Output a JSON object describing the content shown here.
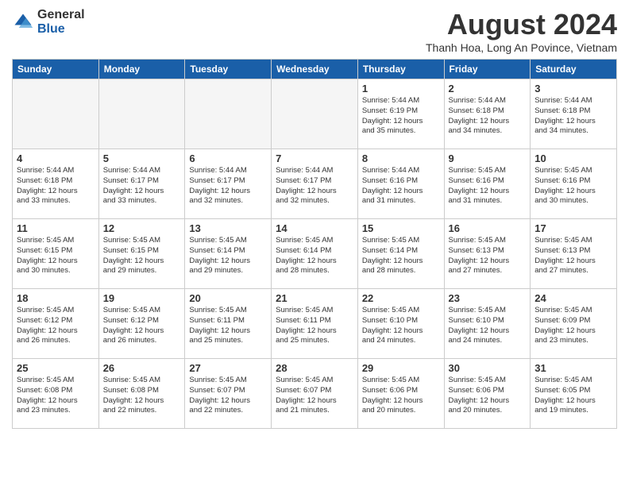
{
  "header": {
    "logo_general": "General",
    "logo_blue": "Blue",
    "month_year": "August 2024",
    "location": "Thanh Hoa, Long An Povince, Vietnam"
  },
  "weekdays": [
    "Sunday",
    "Monday",
    "Tuesday",
    "Wednesday",
    "Thursday",
    "Friday",
    "Saturday"
  ],
  "weeks": [
    [
      {
        "day": "",
        "empty": true
      },
      {
        "day": "",
        "empty": true
      },
      {
        "day": "",
        "empty": true
      },
      {
        "day": "",
        "empty": true
      },
      {
        "day": "1",
        "lines": [
          "Sunrise: 5:44 AM",
          "Sunset: 6:19 PM",
          "Daylight: 12 hours",
          "and 35 minutes."
        ]
      },
      {
        "day": "2",
        "lines": [
          "Sunrise: 5:44 AM",
          "Sunset: 6:18 PM",
          "Daylight: 12 hours",
          "and 34 minutes."
        ]
      },
      {
        "day": "3",
        "lines": [
          "Sunrise: 5:44 AM",
          "Sunset: 6:18 PM",
          "Daylight: 12 hours",
          "and 34 minutes."
        ]
      }
    ],
    [
      {
        "day": "4",
        "lines": [
          "Sunrise: 5:44 AM",
          "Sunset: 6:18 PM",
          "Daylight: 12 hours",
          "and 33 minutes."
        ]
      },
      {
        "day": "5",
        "lines": [
          "Sunrise: 5:44 AM",
          "Sunset: 6:17 PM",
          "Daylight: 12 hours",
          "and 33 minutes."
        ]
      },
      {
        "day": "6",
        "lines": [
          "Sunrise: 5:44 AM",
          "Sunset: 6:17 PM",
          "Daylight: 12 hours",
          "and 32 minutes."
        ]
      },
      {
        "day": "7",
        "lines": [
          "Sunrise: 5:44 AM",
          "Sunset: 6:17 PM",
          "Daylight: 12 hours",
          "and 32 minutes."
        ]
      },
      {
        "day": "8",
        "lines": [
          "Sunrise: 5:44 AM",
          "Sunset: 6:16 PM",
          "Daylight: 12 hours",
          "and 31 minutes."
        ]
      },
      {
        "day": "9",
        "lines": [
          "Sunrise: 5:45 AM",
          "Sunset: 6:16 PM",
          "Daylight: 12 hours",
          "and 31 minutes."
        ]
      },
      {
        "day": "10",
        "lines": [
          "Sunrise: 5:45 AM",
          "Sunset: 6:16 PM",
          "Daylight: 12 hours",
          "and 30 minutes."
        ]
      }
    ],
    [
      {
        "day": "11",
        "lines": [
          "Sunrise: 5:45 AM",
          "Sunset: 6:15 PM",
          "Daylight: 12 hours",
          "and 30 minutes."
        ]
      },
      {
        "day": "12",
        "lines": [
          "Sunrise: 5:45 AM",
          "Sunset: 6:15 PM",
          "Daylight: 12 hours",
          "and 29 minutes."
        ]
      },
      {
        "day": "13",
        "lines": [
          "Sunrise: 5:45 AM",
          "Sunset: 6:14 PM",
          "Daylight: 12 hours",
          "and 29 minutes."
        ]
      },
      {
        "day": "14",
        "lines": [
          "Sunrise: 5:45 AM",
          "Sunset: 6:14 PM",
          "Daylight: 12 hours",
          "and 28 minutes."
        ]
      },
      {
        "day": "15",
        "lines": [
          "Sunrise: 5:45 AM",
          "Sunset: 6:14 PM",
          "Daylight: 12 hours",
          "and 28 minutes."
        ]
      },
      {
        "day": "16",
        "lines": [
          "Sunrise: 5:45 AM",
          "Sunset: 6:13 PM",
          "Daylight: 12 hours",
          "and 27 minutes."
        ]
      },
      {
        "day": "17",
        "lines": [
          "Sunrise: 5:45 AM",
          "Sunset: 6:13 PM",
          "Daylight: 12 hours",
          "and 27 minutes."
        ]
      }
    ],
    [
      {
        "day": "18",
        "lines": [
          "Sunrise: 5:45 AM",
          "Sunset: 6:12 PM",
          "Daylight: 12 hours",
          "and 26 minutes."
        ]
      },
      {
        "day": "19",
        "lines": [
          "Sunrise: 5:45 AM",
          "Sunset: 6:12 PM",
          "Daylight: 12 hours",
          "and 26 minutes."
        ]
      },
      {
        "day": "20",
        "lines": [
          "Sunrise: 5:45 AM",
          "Sunset: 6:11 PM",
          "Daylight: 12 hours",
          "and 25 minutes."
        ]
      },
      {
        "day": "21",
        "lines": [
          "Sunrise: 5:45 AM",
          "Sunset: 6:11 PM",
          "Daylight: 12 hours",
          "and 25 minutes."
        ]
      },
      {
        "day": "22",
        "lines": [
          "Sunrise: 5:45 AM",
          "Sunset: 6:10 PM",
          "Daylight: 12 hours",
          "and 24 minutes."
        ]
      },
      {
        "day": "23",
        "lines": [
          "Sunrise: 5:45 AM",
          "Sunset: 6:10 PM",
          "Daylight: 12 hours",
          "and 24 minutes."
        ]
      },
      {
        "day": "24",
        "lines": [
          "Sunrise: 5:45 AM",
          "Sunset: 6:09 PM",
          "Daylight: 12 hours",
          "and 23 minutes."
        ]
      }
    ],
    [
      {
        "day": "25",
        "lines": [
          "Sunrise: 5:45 AM",
          "Sunset: 6:08 PM",
          "Daylight: 12 hours",
          "and 23 minutes."
        ]
      },
      {
        "day": "26",
        "lines": [
          "Sunrise: 5:45 AM",
          "Sunset: 6:08 PM",
          "Daylight: 12 hours",
          "and 22 minutes."
        ]
      },
      {
        "day": "27",
        "lines": [
          "Sunrise: 5:45 AM",
          "Sunset: 6:07 PM",
          "Daylight: 12 hours",
          "and 22 minutes."
        ]
      },
      {
        "day": "28",
        "lines": [
          "Sunrise: 5:45 AM",
          "Sunset: 6:07 PM",
          "Daylight: 12 hours",
          "and 21 minutes."
        ]
      },
      {
        "day": "29",
        "lines": [
          "Sunrise: 5:45 AM",
          "Sunset: 6:06 PM",
          "Daylight: 12 hours",
          "and 20 minutes."
        ]
      },
      {
        "day": "30",
        "lines": [
          "Sunrise: 5:45 AM",
          "Sunset: 6:06 PM",
          "Daylight: 12 hours",
          "and 20 minutes."
        ]
      },
      {
        "day": "31",
        "lines": [
          "Sunrise: 5:45 AM",
          "Sunset: 6:05 PM",
          "Daylight: 12 hours",
          "and 19 minutes."
        ]
      }
    ]
  ]
}
